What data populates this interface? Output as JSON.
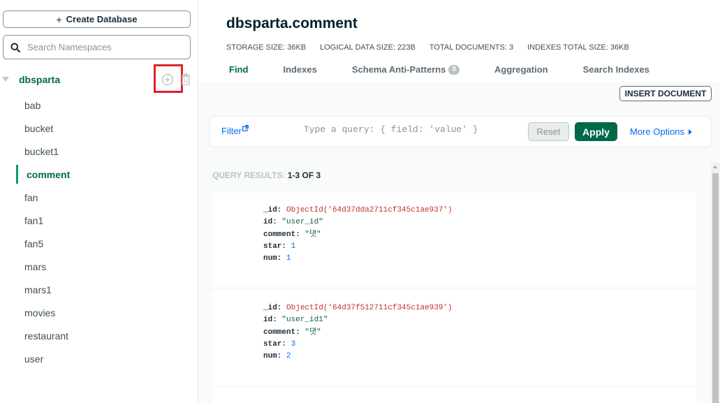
{
  "sidebar": {
    "create_label": "Create Database",
    "search_placeholder": "Search Namespaces",
    "database": "dbsparta",
    "collections": [
      {
        "name": "bab",
        "active": false
      },
      {
        "name": "bucket",
        "active": false
      },
      {
        "name": "bucket1",
        "active": false
      },
      {
        "name": "comment",
        "active": true
      },
      {
        "name": "fan",
        "active": false
      },
      {
        "name": "fan1",
        "active": false
      },
      {
        "name": "fan5",
        "active": false
      },
      {
        "name": "mars",
        "active": false
      },
      {
        "name": "mars1",
        "active": false
      },
      {
        "name": "movies",
        "active": false
      },
      {
        "name": "restaurant",
        "active": false
      },
      {
        "name": "user",
        "active": false
      }
    ]
  },
  "header": {
    "title": "dbsparta.comment",
    "stats": [
      "STORAGE SIZE: 36KB",
      "LOGICAL DATA SIZE: 223B",
      "TOTAL DOCUMENTS: 3",
      "INDEXES TOTAL SIZE: 36KB"
    ]
  },
  "tabs": [
    {
      "label": "Find",
      "active": true,
      "badge": ""
    },
    {
      "label": "Indexes",
      "active": false,
      "badge": ""
    },
    {
      "label": "Schema Anti-Patterns",
      "active": false,
      "badge": "0"
    },
    {
      "label": "Aggregation",
      "active": false,
      "badge": ""
    },
    {
      "label": "Search Indexes",
      "active": false,
      "badge": ""
    }
  ],
  "toolbar": {
    "insert_label": "INSERT DOCUMENT"
  },
  "query": {
    "filter_label": "Filter",
    "placeholder": "Type a query: { field: 'value' }",
    "reset_label": "Reset",
    "apply_label": "Apply",
    "more_label": "More Options"
  },
  "results": {
    "label": "QUERY RESULTS:",
    "count": "1-3 OF 3"
  },
  "documents": [
    {
      "_id": "ObjectId('64d37dda2711cf345c1ae937')",
      "id": "\"user_id\"",
      "comment": "\"댓\"",
      "star": "1",
      "num": "1"
    },
    {
      "_id": "ObjectId('64d37f512711cf345c1ae939')",
      "id": "\"user_id1\"",
      "comment": "\"댓\"",
      "star": "3",
      "num": "2"
    }
  ],
  "colors": {
    "accent": "#00684a",
    "link": "#016bf8",
    "highlight": "#e0212b"
  }
}
